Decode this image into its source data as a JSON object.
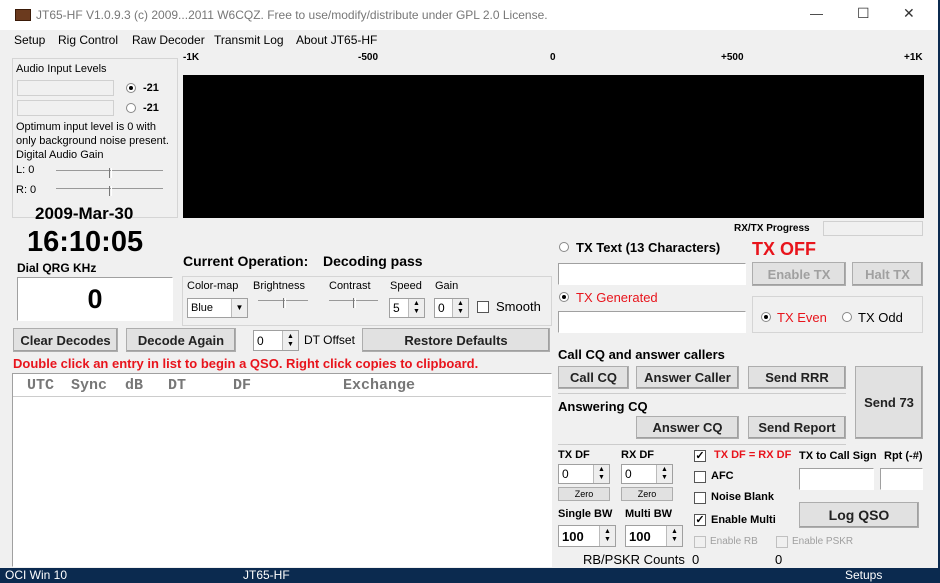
{
  "window": {
    "title": "JT65-HF V1.0.9.3 (c) 2009...2011 W6CQZ.  Free to use/modify/distribute under GPL 2.0 License.",
    "app_icon": "radio-icon",
    "minimize": "—",
    "maximize": "☐",
    "close": "✕"
  },
  "menu": [
    "Setup",
    "Rig Control",
    "Raw Decoder",
    "Transmit Log",
    "About JT65-HF"
  ],
  "audio": {
    "title": "Audio Input Levels",
    "left_level": "-21",
    "right_level": "-21",
    "hint1": "Optimum input level is 0 with",
    "hint2": "only background noise present.",
    "gain_label": "Digital Audio Gain",
    "l_label": "L: 0",
    "r_label": "R: 0"
  },
  "clock": {
    "date": "2009-Mar-30",
    "time": "16:10:05"
  },
  "dial": {
    "label": "Dial QRG KHz",
    "value": "0"
  },
  "waterfall": {
    "scale": [
      "-1K",
      "-500",
      "0",
      "+500",
      "+1K"
    ]
  },
  "progress": {
    "label": "RX/TX Progress",
    "value": 0
  },
  "operation": {
    "label": "Current Operation:",
    "value": "Decoding pass"
  },
  "display": {
    "colormap_label": "Color-map",
    "colormap_value": "Blue",
    "brightness_label": "Brightness",
    "contrast_label": "Contrast",
    "speed_label": "Speed",
    "speed_value": "5",
    "gain_label": "Gain",
    "gain_value": "0",
    "smooth_label": "Smooth"
  },
  "actions": {
    "clear": "Clear Decodes",
    "decode_again": "Decode Again",
    "dt_value": "0",
    "dt_label": "DT Offset",
    "restore": "Restore Defaults"
  },
  "hint": "Double click an entry in list to begin a QSO.  Right click copies to clipboard.",
  "list": {
    "columns": [
      "UTC",
      "Sync",
      "dB",
      "DT",
      "DF",
      "Exchange"
    ]
  },
  "tx": {
    "text_label": "TX Text (13 Characters)",
    "status": "TX OFF",
    "enable": "Enable TX",
    "halt": "Halt TX",
    "generated_label": "TX Generated",
    "even": "TX Even",
    "odd": "TX Odd",
    "status_color": "#e8141c"
  },
  "cq": {
    "title": "Call CQ and answer callers",
    "call_cq": "Call CQ",
    "answer_caller": "Answer Caller",
    "send_rrr": "Send RRR",
    "send73": "Send 73",
    "answering_title": "Answering CQ",
    "answer_cq": "Answer CQ",
    "send_report": "Send Report"
  },
  "df": {
    "tx_label": "TX DF",
    "tx_value": "0",
    "rx_label": "RX DF",
    "rx_value": "0",
    "zero": "Zero",
    "single_bw_label": "Single BW",
    "single_bw": "100",
    "multi_bw_label": "Multi BW",
    "multi_bw": "100"
  },
  "options": {
    "txdf_eq": "TX DF = RX DF",
    "afc": "AFC",
    "noise_blank": "Noise Blank",
    "enable_multi": "Enable Multi",
    "enable_rb": "Enable RB",
    "enable_pskr": "Enable PSKR"
  },
  "log": {
    "call_label": "TX to Call Sign",
    "rpt_label": "Rpt (-#)",
    "log_qso": "Log QSO"
  },
  "counts": {
    "label": "RB/PSKR Counts",
    "rb": "0",
    "pskr": "0"
  },
  "taskbar": [
    "OCI Win 10",
    "JT65-HF",
    "Setups"
  ]
}
